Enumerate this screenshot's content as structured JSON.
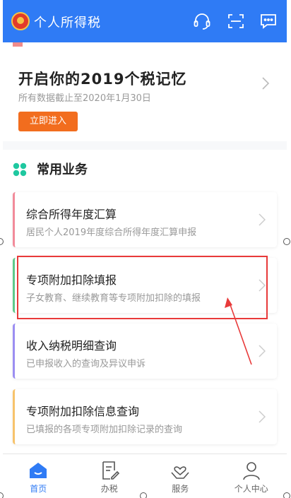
{
  "header": {
    "title": "个人所得税",
    "icons": [
      "headset-icon",
      "scan-icon",
      "message-icon"
    ],
    "color": "#2f7bf5"
  },
  "banner": {
    "title": "开启你的2019个税记忆",
    "subtitle": "所有数据截止至2020年1月30日",
    "button_label": "立即进入",
    "button_color": "#f26d1e"
  },
  "section": {
    "title": "常用业务",
    "icon": "clover-icon",
    "icon_color": "#1fc8a0"
  },
  "services": [
    {
      "title": "综合所得年度汇算",
      "subtitle": "居民个人2019年度综合所得年度汇算申报",
      "accent": "#f28b9a"
    },
    {
      "title": "专项附加扣除填报",
      "subtitle": "子女教育、继续教育等专项附加扣除的填报",
      "accent": "#5fc98a"
    },
    {
      "title": "收入纳税明细查询",
      "subtitle": "已申报收入的查询及异议申诉",
      "accent": "#9b8ef2"
    },
    {
      "title": "专项附加扣除信息查询",
      "subtitle": "已填报的各项专项附加扣除记录的查询",
      "accent": "#f7c36b"
    }
  ],
  "annotation": {
    "highlight_color": "#e83a3a"
  },
  "tabbar": {
    "tabs": [
      {
        "label": "首页",
        "icon": "home-icon",
        "active": true
      },
      {
        "label": "办税",
        "icon": "document-edit-icon",
        "active": false
      },
      {
        "label": "服务",
        "icon": "heart-hands-icon",
        "active": false
      },
      {
        "label": "个人中心",
        "icon": "user-icon",
        "active": false
      }
    ]
  }
}
